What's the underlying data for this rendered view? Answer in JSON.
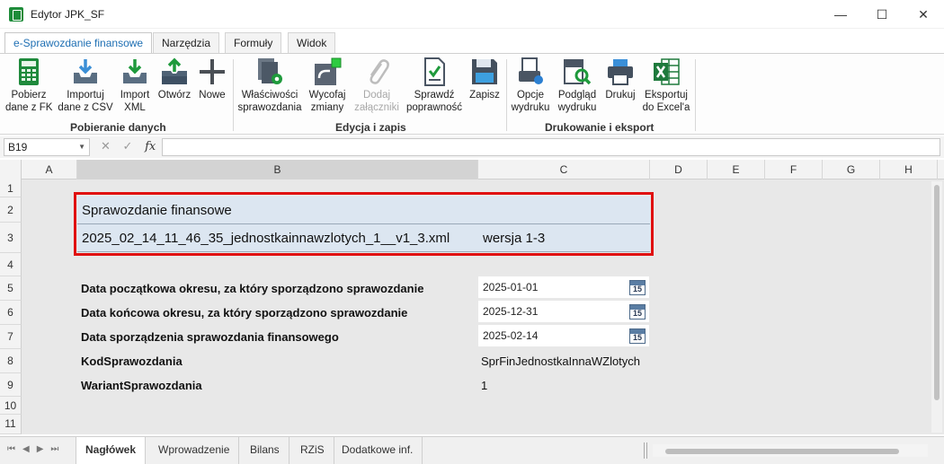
{
  "window": {
    "title": "Edytor JPK_SF",
    "minimize": "—",
    "maximize": "☐",
    "close": "✕"
  },
  "ribbon_tabs": [
    "e-Sprawozdanie finansowe",
    "Narzędzia",
    "Formuły",
    "Widok"
  ],
  "ribbon": {
    "groups": [
      "Pobieranie danych",
      "Edycja i zapis",
      "Drukowanie i eksport"
    ],
    "buttons": {
      "pobierz": "Pobierz\ndane z FK",
      "importuj_csv": "Importuj\ndane z CSV",
      "import_xml": "Import\nXML",
      "otworz": "Otwórz",
      "nowe": "Nowe",
      "wlasciwosci": "Właściwości\nsprawozdania",
      "wycofaj": "Wycofaj\nzmiany",
      "dodaj": "Dodaj\nzałączniki",
      "sprawdz": "Sprawdź\npoprawność",
      "zapisz": "Zapisz",
      "opcje": "Opcje\nwydruku",
      "podglad": "Podgląd\nwydruku",
      "drukuj": "Drukuj",
      "eksport": "Eksportuj\ndo Excel'a"
    }
  },
  "formula_bar": {
    "cell_ref": "B19",
    "cancel": "✕",
    "confirm": "✓",
    "fx": "fx",
    "value": ""
  },
  "columns": [
    "A",
    "B",
    "C",
    "D",
    "E",
    "F",
    "G",
    "H"
  ],
  "rows": [
    "1",
    "2",
    "3",
    "4",
    "5",
    "6",
    "7",
    "8",
    "9",
    "10",
    "11"
  ],
  "sheet": {
    "title": "Sprawozdanie finansowe",
    "filename": "2025_02_14_11_46_35_jednostkainnawzlotych_1__v1_3.xml",
    "version": "wersja 1-3",
    "fields": [
      {
        "label": "Data początkowa okresu, za który sporządzono sprawozdanie",
        "value": "2025-01-01"
      },
      {
        "label": "Data końcowa okresu, za który sporządzono sprawozdanie",
        "value": "2025-12-31"
      },
      {
        "label": "Data sporządzenia sprawozdania finansowego",
        "value": "2025-02-14"
      },
      {
        "label": "KodSprawozdania",
        "value": "SprFinJednostkaInnaWZlotych"
      },
      {
        "label": "WariantSprawozdania",
        "value": "1"
      }
    ],
    "calendar_day": "15"
  },
  "sheet_tabs": [
    "Nagłówek",
    "Wprowadzenie",
    "Bilans",
    "RZiS",
    "Dodatkowe inf."
  ],
  "colors": {
    "accent": "#1e6fb3",
    "highlight_border": "#e01010",
    "band": "#dce6f1"
  }
}
